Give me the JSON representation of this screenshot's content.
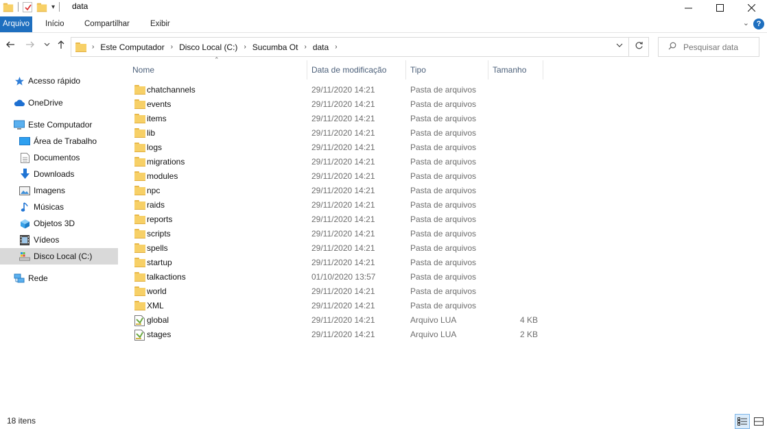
{
  "window": {
    "title": "data",
    "controls": [
      "minimize-icon",
      "maximize-icon",
      "close-icon"
    ]
  },
  "ribbon": {
    "tabs": [
      {
        "label": "Arquivo",
        "active": true
      },
      {
        "label": "Início",
        "active": false
      },
      {
        "label": "Compartilhar",
        "active": false
      },
      {
        "label": "Exibir",
        "active": false
      }
    ],
    "help": "?"
  },
  "address": {
    "breadcrumbs": [
      "Este Computador",
      "Disco Local (C:)",
      "Sucumba Ot",
      "data"
    ]
  },
  "search": {
    "placeholder": "Pesquisar data"
  },
  "nav": {
    "items": [
      {
        "label": "Acesso rápido",
        "icon": "star-icon",
        "indent": 0
      },
      {
        "label": "OneDrive",
        "icon": "cloud-icon",
        "indent": 0
      },
      {
        "label": "Este Computador",
        "icon": "computer-icon",
        "indent": 0
      },
      {
        "label": "Área de Trabalho",
        "icon": "desktop-icon",
        "indent": 1
      },
      {
        "label": "Documentos",
        "icon": "documents-icon",
        "indent": 1
      },
      {
        "label": "Downloads",
        "icon": "download-icon",
        "indent": 1
      },
      {
        "label": "Imagens",
        "icon": "pictures-icon",
        "indent": 1
      },
      {
        "label": "Músicas",
        "icon": "music-icon",
        "indent": 1
      },
      {
        "label": "Objetos 3D",
        "icon": "cube-icon",
        "indent": 1
      },
      {
        "label": "Vídeos",
        "icon": "video-icon",
        "indent": 1
      },
      {
        "label": "Disco Local (C:)",
        "icon": "drive-icon",
        "indent": 1,
        "selected": true
      },
      {
        "label": "Rede",
        "icon": "network-icon",
        "indent": 0
      }
    ]
  },
  "columns": {
    "name": "Nome",
    "date": "Data de modificação",
    "type": "Tipo",
    "size": "Tamanho"
  },
  "files": [
    {
      "name": "chatchannels",
      "date": "29/11/2020 14:21",
      "type": "Pasta de arquivos",
      "size": "",
      "icon": "folder-icon"
    },
    {
      "name": "events",
      "date": "29/11/2020 14:21",
      "type": "Pasta de arquivos",
      "size": "",
      "icon": "folder-icon"
    },
    {
      "name": "items",
      "date": "29/11/2020 14:21",
      "type": "Pasta de arquivos",
      "size": "",
      "icon": "folder-icon"
    },
    {
      "name": "lib",
      "date": "29/11/2020 14:21",
      "type": "Pasta de arquivos",
      "size": "",
      "icon": "folder-icon"
    },
    {
      "name": "logs",
      "date": "29/11/2020 14:21",
      "type": "Pasta de arquivos",
      "size": "",
      "icon": "folder-icon"
    },
    {
      "name": "migrations",
      "date": "29/11/2020 14:21",
      "type": "Pasta de arquivos",
      "size": "",
      "icon": "folder-icon"
    },
    {
      "name": "modules",
      "date": "29/11/2020 14:21",
      "type": "Pasta de arquivos",
      "size": "",
      "icon": "folder-icon"
    },
    {
      "name": "npc",
      "date": "29/11/2020 14:21",
      "type": "Pasta de arquivos",
      "size": "",
      "icon": "folder-icon"
    },
    {
      "name": "raids",
      "date": "29/11/2020 14:21",
      "type": "Pasta de arquivos",
      "size": "",
      "icon": "folder-icon"
    },
    {
      "name": "reports",
      "date": "29/11/2020 14:21",
      "type": "Pasta de arquivos",
      "size": "",
      "icon": "folder-icon"
    },
    {
      "name": "scripts",
      "date": "29/11/2020 14:21",
      "type": "Pasta de arquivos",
      "size": "",
      "icon": "folder-icon"
    },
    {
      "name": "spells",
      "date": "29/11/2020 14:21",
      "type": "Pasta de arquivos",
      "size": "",
      "icon": "folder-icon"
    },
    {
      "name": "startup",
      "date": "29/11/2020 14:21",
      "type": "Pasta de arquivos",
      "size": "",
      "icon": "folder-icon"
    },
    {
      "name": "talkactions",
      "date": "01/10/2020 13:57",
      "type": "Pasta de arquivos",
      "size": "",
      "icon": "folder-icon"
    },
    {
      "name": "world",
      "date": "29/11/2020 14:21",
      "type": "Pasta de arquivos",
      "size": "",
      "icon": "folder-icon"
    },
    {
      "name": "XML",
      "date": "29/11/2020 14:21",
      "type": "Pasta de arquivos",
      "size": "",
      "icon": "folder-icon"
    },
    {
      "name": "global",
      "date": "29/11/2020 14:21",
      "type": "Arquivo LUA",
      "size": "4 KB",
      "icon": "lua-file-icon"
    },
    {
      "name": "stages",
      "date": "29/11/2020 14:21",
      "type": "Arquivo LUA",
      "size": "2 KB",
      "icon": "lua-file-icon"
    }
  ],
  "status": {
    "count": "18 itens"
  },
  "colors": {
    "accent": "#1e6fbf",
    "folder": "#f7d067",
    "selected_nav": "#d9d9d9"
  }
}
